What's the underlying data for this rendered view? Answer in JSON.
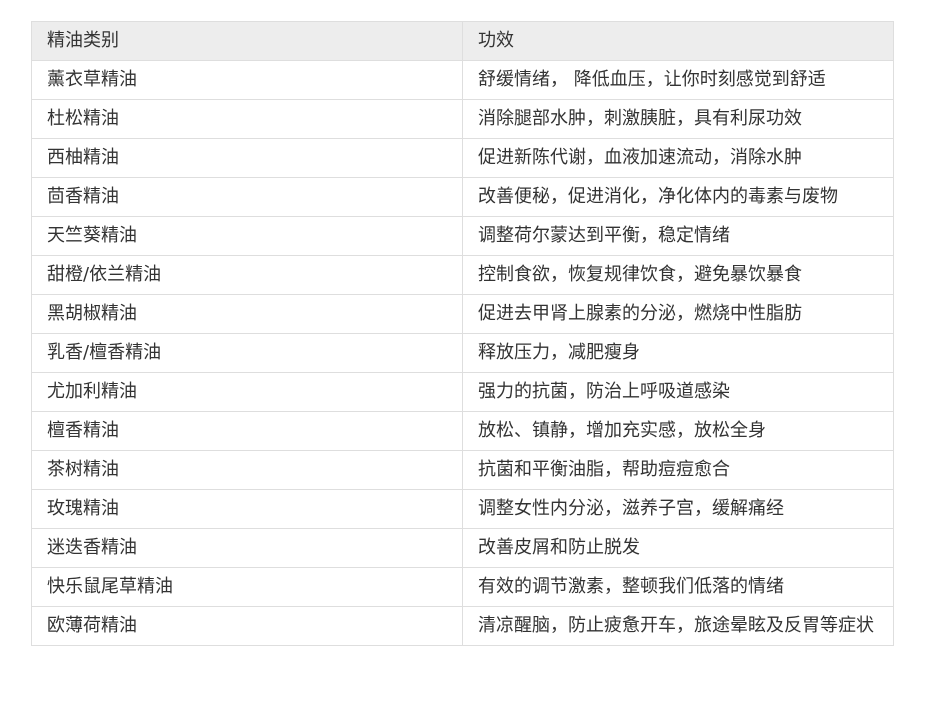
{
  "table": {
    "headers": [
      "精油类别",
      "功效"
    ],
    "rows": [
      [
        "薰衣草精油",
        "舒缓情绪， 降低血压，让你时刻感觉到舒适"
      ],
      [
        "杜松精油",
        "消除腿部水肿，刺激胰脏，具有利尿功效"
      ],
      [
        "西柚精油",
        "促进新陈代谢，血液加速流动，消除水肿"
      ],
      [
        "茴香精油",
        "改善便秘，促进消化，净化体内的毒素与废物"
      ],
      [
        "天竺葵精油",
        "调整荷尔蒙达到平衡，稳定情绪"
      ],
      [
        "甜橙/依兰精油",
        "控制食欲，恢复规律饮食，避免暴饮暴食"
      ],
      [
        "黑胡椒精油",
        "促进去甲肾上腺素的分泌，燃烧中性脂肪"
      ],
      [
        "乳香/檀香精油",
        "释放压力，减肥瘦身"
      ],
      [
        "尤加利精油",
        "强力的抗菌，防治上呼吸道感染"
      ],
      [
        "檀香精油",
        "放松、镇静，增加充实感，放松全身"
      ],
      [
        "茶树精油",
        "抗菌和平衡油脂，帮助痘痘愈合"
      ],
      [
        "玫瑰精油",
        "调整女性内分泌，滋养子宫，缓解痛经"
      ],
      [
        "迷迭香精油",
        "改善皮屑和防止脱发"
      ],
      [
        "快乐鼠尾草精油",
        "有效的调节激素，整顿我们低落的情绪"
      ],
      [
        "欧薄荷精油",
        "清凉醒脑，防止疲惫开车，旅途晕眩及反胃等症状"
      ]
    ]
  }
}
